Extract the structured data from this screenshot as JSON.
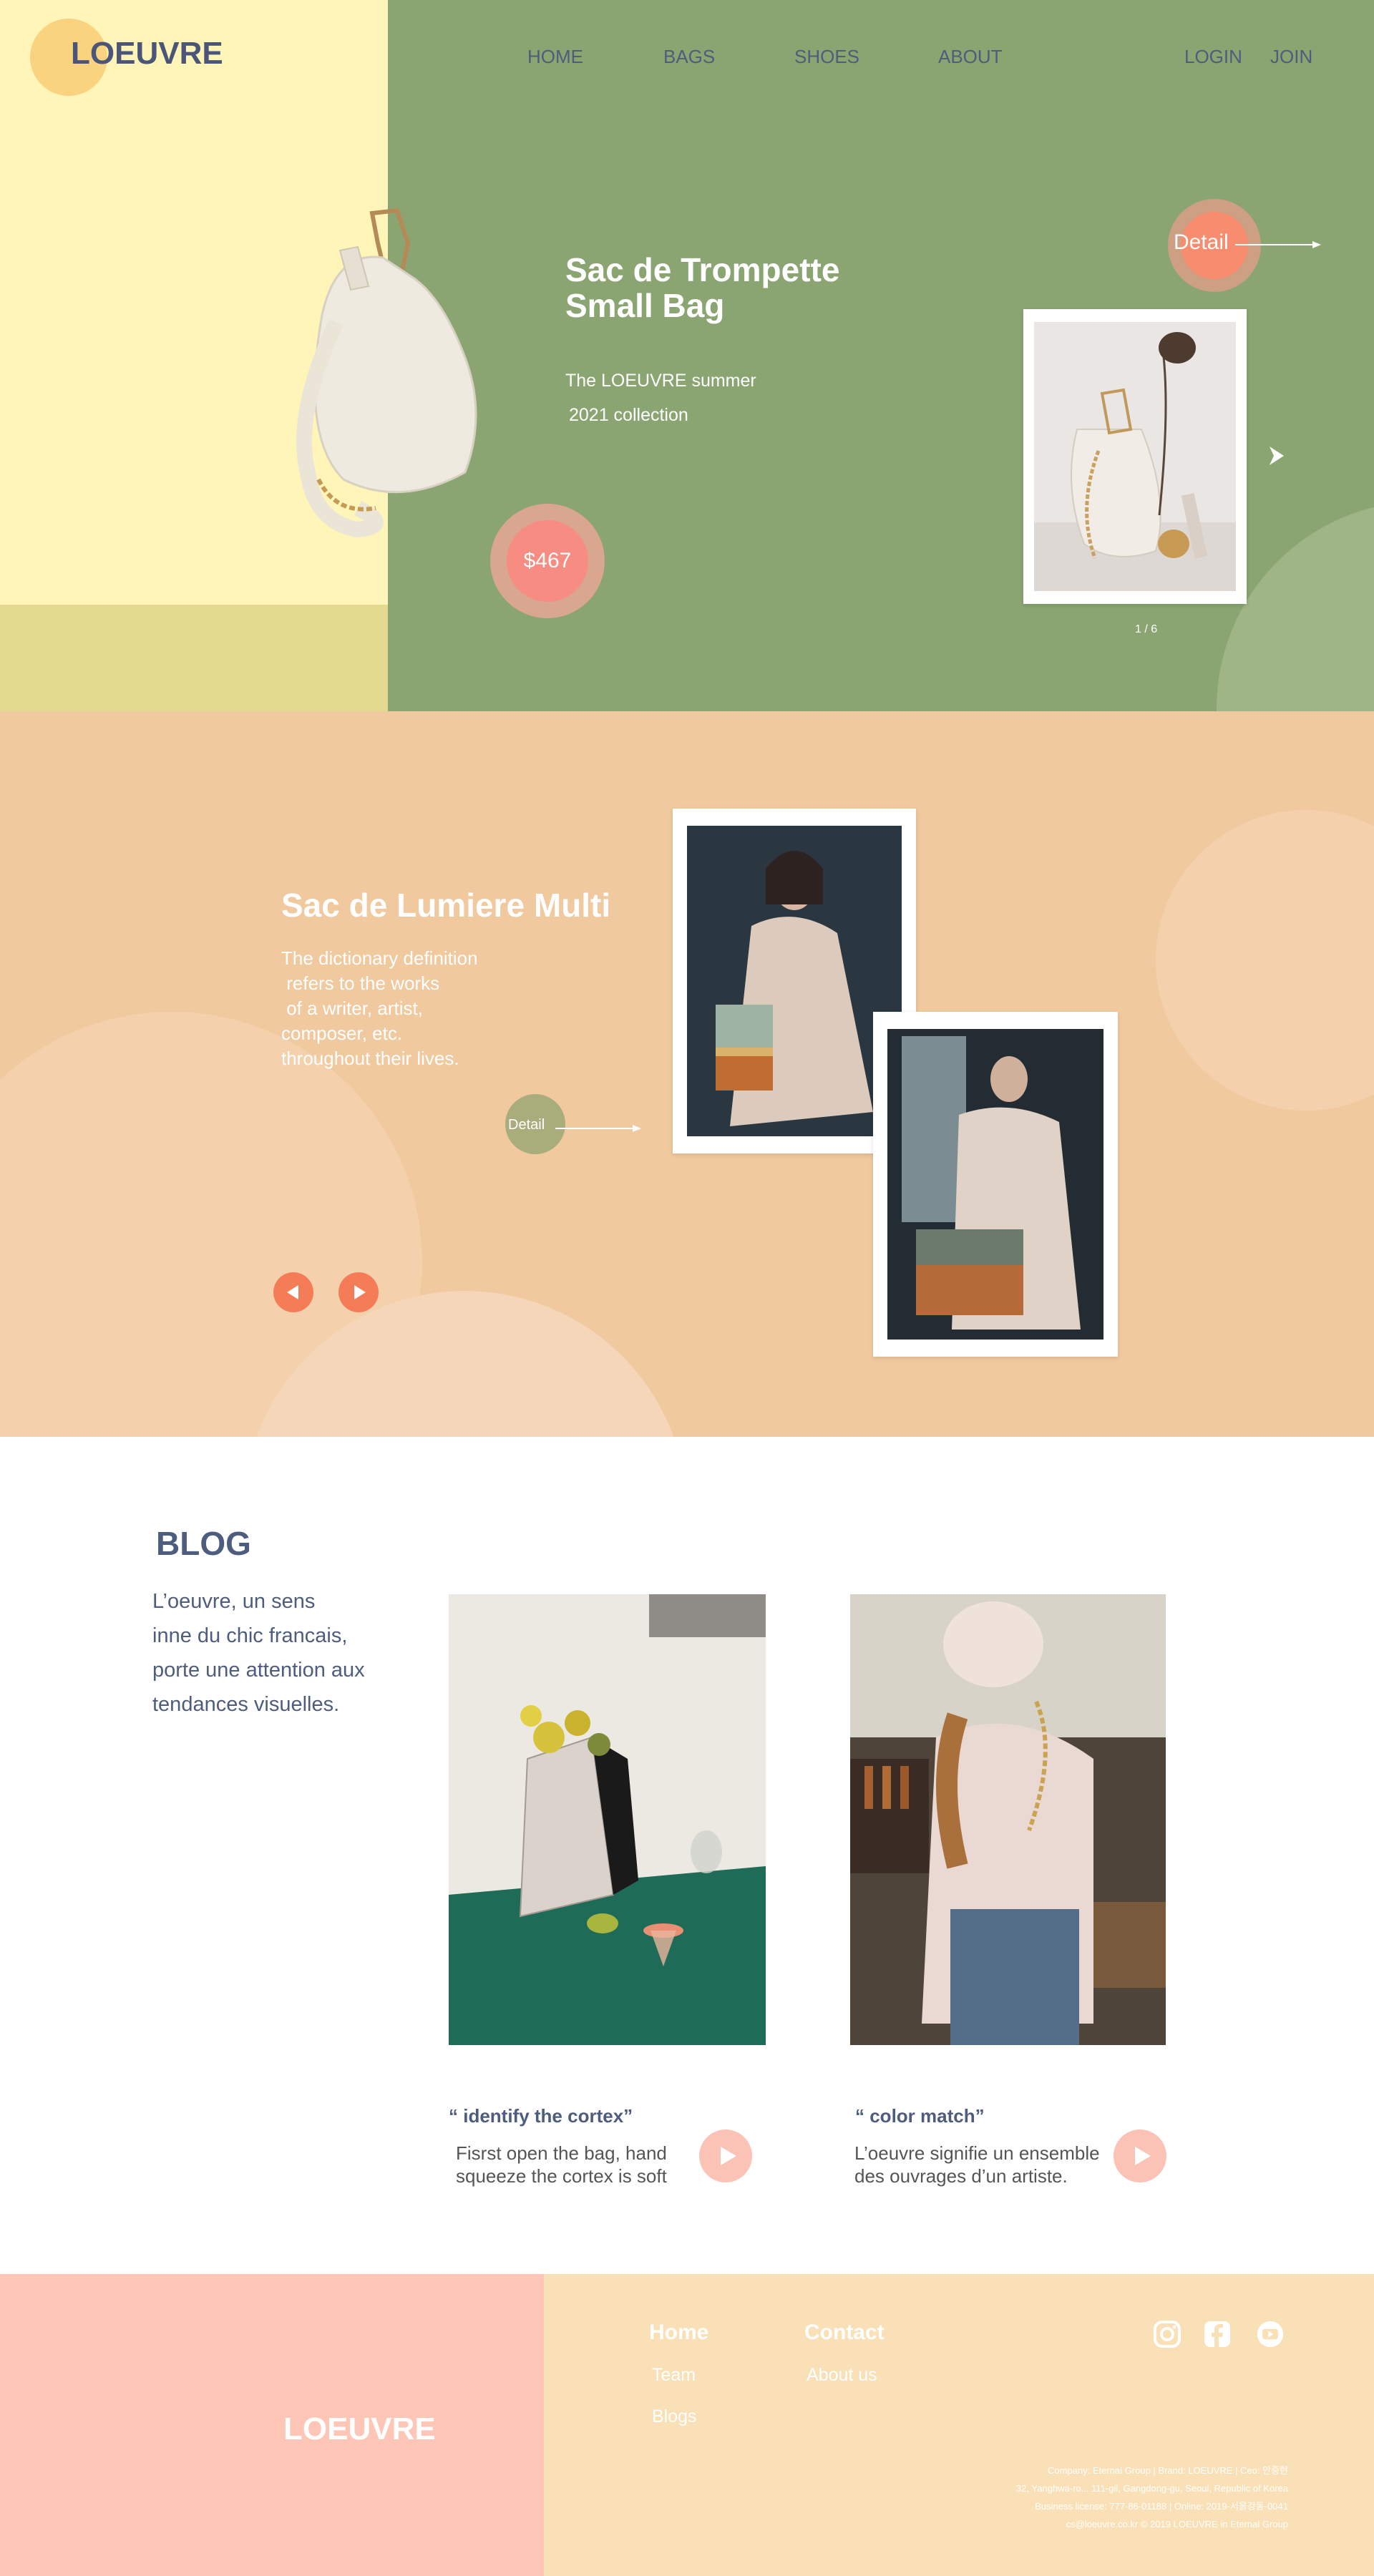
{
  "brand": {
    "logo": "LOEUVRE"
  },
  "nav": {
    "items": [
      "HOME",
      "BAGS",
      "SHOES",
      "ABOUT"
    ],
    "login": "LOGIN",
    "join": "JOIN"
  },
  "hero": {
    "title_line1": "Sac de Trompette",
    "title_line2": "Small Bag",
    "subtitle_line1": "The LOEUVRE summer",
    "subtitle_line2": "2021 collection",
    "price": "$467",
    "detail_label": "Detail",
    "pagination": "1 / 6"
  },
  "feature": {
    "title": "Sac de Lumiere Multi",
    "text": "The dictionary definition\n refers to the works\n of a writer, artist,\ncomposer, etc.\nthroughout their lives.",
    "detail_label": "Detail"
  },
  "blog": {
    "title": "BLOG",
    "intro": "L’oeuvre, un sens\ninne du chic francais,\nporte une attention aux\ntendances visuelles.",
    "cards": [
      {
        "title": "“ identify the cortex”",
        "text": "Fisrst open the bag, hand\nsqueeze the cortex is soft"
      },
      {
        "title": "“ color match”",
        "text": "L’oeuvre signifie un ensemble\ndes ouvrages d’un artiste."
      }
    ]
  },
  "footer": {
    "logo": "LOEUVRE",
    "col1_head": "Home",
    "col1_links": [
      "Team",
      "Blogs"
    ],
    "col2_head": "Contact",
    "col2_links": [
      "About us"
    ],
    "info": "Company: Eternal Group | Brand: LOEUVRE | Ceo: 안중현\n32, Yanghwa-ro... 111-gil, Gangdong-gu, Seoul, Republic of Korea\nBusiness license: 777-86-01188 | Online: 2019-서울강동-0041\ncs@loeuvre.co.kr © 2019 LOEUVRE in Eternal Group"
  },
  "colors": {
    "hero_green": "#8aa572",
    "hero_yellow": "#fff5b8",
    "section_peach": "#f1c99f",
    "accent_coral": "#f78c6e",
    "navy_text": "#4e5d7d",
    "footer_pink": "#fec6b6",
    "footer_cream": "#fae0b6"
  },
  "icons": [
    "arrow-right-icon",
    "chevron-right-icon",
    "arrow-left-icon",
    "play-icon",
    "instagram-icon",
    "facebook-icon",
    "youtube-icon"
  ]
}
